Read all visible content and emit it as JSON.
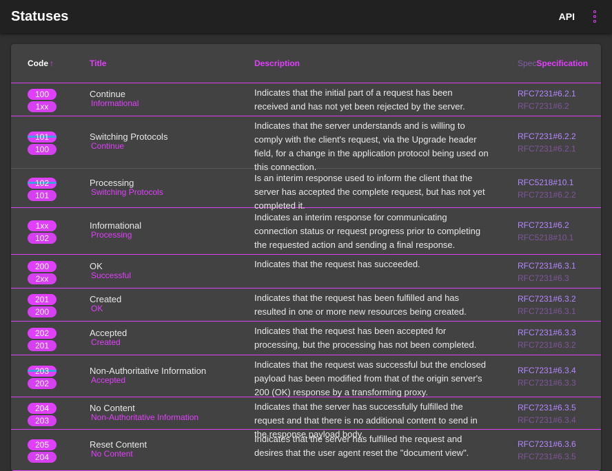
{
  "header": {
    "title": "Statuses",
    "api_label": "API",
    "menu_icon": "more-vert-icon"
  },
  "table": {
    "columns": {
      "code": "Code",
      "code_sort_arrow": "↑",
      "title": "Title",
      "description": "Description",
      "specification": "Specification",
      "spec_ghost": "Spec"
    },
    "rows": [
      {
        "code": "100",
        "ghost_code": "1xx",
        "title": "Continue",
        "ghost_title": "Informational",
        "description": "Indicates that the initial part of a request has been received and has not yet been rejected by the server.",
        "spec": "RFC7231#6.2.1",
        "ghost_spec": "RFC7231#6.2"
      },
      {
        "code": "101",
        "ghost_code": "100",
        "title": "Switching Protocols",
        "ghost_title": "Continue",
        "description": "Indicates that the server understands and is willing to comply with the client's request, via the Upgrade header field, for a change in the application protocol being used on this connection.",
        "spec": "RFC7231#6.2.2",
        "ghost_spec": "RFC7231#6.2.1"
      },
      {
        "code": "102",
        "ghost_code": "101",
        "title": "Processing",
        "ghost_title": "Switching Protocols",
        "description": "Is an interim response used to inform the client that the server has accepted the complete request, but has not yet completed it.",
        "spec": "RFC5218#10.1",
        "ghost_spec": "RFC7231#6.2.2"
      },
      {
        "code": "1xx",
        "ghost_code": "102",
        "title": "Informational",
        "ghost_title": "Processing",
        "description": "Indicates an interim response for communicating connection status or request progress prior to completing the requested action and sending a final response.",
        "spec": "RFC7231#6.2",
        "ghost_spec": "RFC5218#10.1"
      },
      {
        "code": "200",
        "ghost_code": "2xx",
        "title": "OK",
        "ghost_title": "Successful",
        "description": "Indicates that the request has succeeded.",
        "spec": "RFC7231#6.3.1",
        "ghost_spec": "RFC7231#6.3"
      },
      {
        "code": "201",
        "ghost_code": "200",
        "title": "Created",
        "ghost_title": "OK",
        "description": "Indicates that the request has been fulfilled and has resulted in one or more new resources being created.",
        "spec": "RFC7231#6.3.2",
        "ghost_spec": "RFC7231#6.3.1"
      },
      {
        "code": "202",
        "ghost_code": "201",
        "title": "Accepted",
        "ghost_title": "Created",
        "description": "Indicates that the request has been accepted for processing, but the processing has not been completed.",
        "spec": "RFC7231#6.3.3",
        "ghost_spec": "RFC7231#6.3.2"
      },
      {
        "code": "203",
        "ghost_code": "202",
        "title": "Non-Authoritative Information",
        "ghost_title": "Accepted",
        "description": "Indicates that the request was successful but the enclosed payload has been modified from that of the origin server's 200 (OK) response by a transforming proxy.",
        "spec": "RFC7231#6.3.4",
        "ghost_spec": "RFC7231#6.3.3"
      },
      {
        "code": "204",
        "ghost_code": "203",
        "title": "No Content",
        "ghost_title": "Non-Authoritative Information",
        "description": "Indicates that the server has successfully fulfilled the request and that there is no additional content to send in the response payload body.",
        "spec": "RFC7231#6.3.5",
        "ghost_spec": "RFC7231#6.3.4"
      },
      {
        "code": "205",
        "ghost_code": "204",
        "title": "Reset Content",
        "ghost_title": "No Content",
        "description": "Indicates that the server has fulfilled the request and desires that the user agent reset the \"document view\".",
        "spec": "RFC7231#6.3.6",
        "ghost_spec": "RFC7231#6.3.5"
      }
    ]
  },
  "colors": {
    "accent": "#e040fb",
    "link": "#b388ff",
    "appbar": "#212121",
    "card": "#424242",
    "page": "#303030"
  }
}
